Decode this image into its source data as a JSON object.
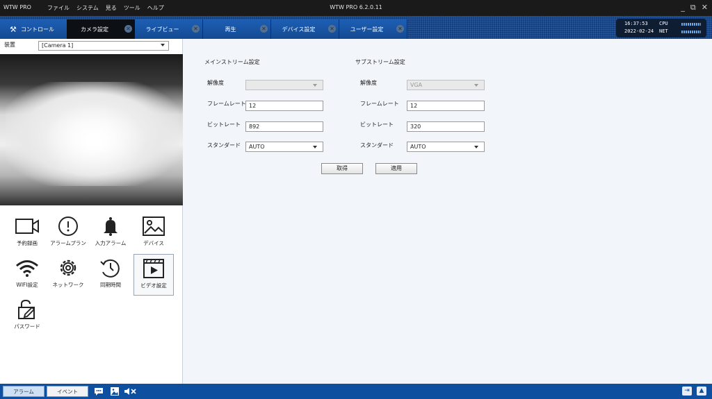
{
  "titlebar": {
    "app_name": "WTW PRO",
    "menus": [
      "ファイル",
      "システム",
      "見る",
      "ツール",
      "ヘルプ"
    ],
    "window_title": "WTW PRO 6.2.0.11"
  },
  "tabs": {
    "control": "コントロール",
    "camera": "カメラ設定",
    "live": "ライブビュー",
    "playback": "再生",
    "device": "デバイス設定",
    "user": "ユーザー設定"
  },
  "clock": {
    "time": "16:37:53",
    "date": "2022-02-24",
    "cpu_label": "CPU",
    "net_label": "NET"
  },
  "sidebar": {
    "device_label": "装置",
    "device_value": "[Camera 1]",
    "functions": [
      {
        "label": "予約録画",
        "icon": "video-camera-icon"
      },
      {
        "label": "アラームプラン",
        "icon": "alert-circle-icon"
      },
      {
        "label": "入力アラーム",
        "icon": "bell-icon"
      },
      {
        "label": "デバイス",
        "icon": "image-icon"
      },
      {
        "label": "WIFI設定",
        "icon": "wifi-icon"
      },
      {
        "label": "ネットワーク",
        "icon": "gear-icon"
      },
      {
        "label": "同期時間",
        "icon": "sync-clock-icon"
      },
      {
        "label": "ビデオ設定",
        "icon": "clapperboard-icon"
      },
      {
        "label": "パスワード",
        "icon": "unlock-edit-icon"
      }
    ]
  },
  "main_stream": {
    "title": "メインストリーム設定",
    "resolution_label": "解像度",
    "resolution_value": "",
    "framerate_label": "フレームレート",
    "framerate_value": "12",
    "bitrate_label": "ビットレート",
    "bitrate_value": "892",
    "standard_label": "スタンダード",
    "standard_value": "AUTO"
  },
  "sub_stream": {
    "title": "サブストリーム設定",
    "resolution_label": "解像度",
    "resolution_value": "VGA",
    "framerate_label": "フレームレート",
    "framerate_value": "12",
    "bitrate_label": "ビットレート",
    "bitrate_value": "320",
    "standard_label": "スタンダード",
    "standard_value": "AUTO"
  },
  "buttons": {
    "fetch": "取得",
    "apply": "適用"
  },
  "bottombar": {
    "alarm": "アラーム",
    "event": "イベント"
  },
  "colors": {
    "tabbar": "#143e7c",
    "bottombar": "#0f4fa0",
    "active_tab": "#0c0f14"
  }
}
